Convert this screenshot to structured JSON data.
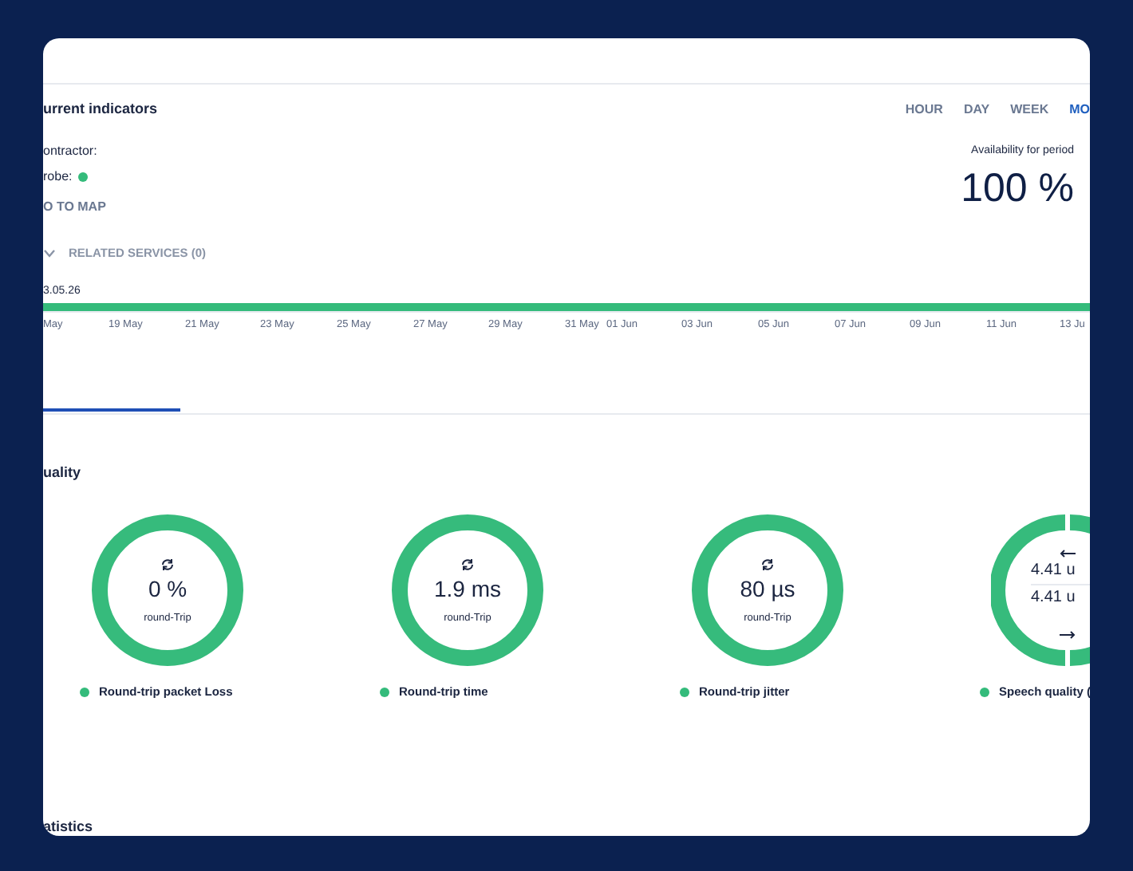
{
  "header": {
    "title": "urrent indicators",
    "periods": [
      {
        "label": "HOUR",
        "selected": false
      },
      {
        "label": "DAY",
        "selected": false
      },
      {
        "label": "WEEK",
        "selected": false
      },
      {
        "label": "MO",
        "selected": true
      }
    ]
  },
  "info": {
    "contractor": "ontractor:",
    "probe": "robe:",
    "map_link": "O TO MAP",
    "related": "RELATED SERVICES (0)"
  },
  "availability": {
    "label": "Availability for period",
    "value": "100 %"
  },
  "timeline": {
    "date": "3.05.26",
    "ticks": [
      "May",
      "19 May",
      "21 May",
      "23 May",
      "25 May",
      "27 May",
      "29 May",
      "31 May",
      "01 Jun",
      "03 Jun",
      "05 Jun",
      "07 Jun",
      "09 Jun",
      "11 Jun",
      "13 Ju"
    ]
  },
  "quality": {
    "title": "uality",
    "gauges": [
      {
        "kind": "single",
        "value": "0 %",
        "caption": "round-Trip",
        "label": "Round-trip packet Loss"
      },
      {
        "kind": "single",
        "value": "1.9 ms",
        "caption": "round-Trip",
        "label": "Round-trip time"
      },
      {
        "kind": "single",
        "value": "80 µs",
        "caption": "round-Trip",
        "label": "Round-trip jitter"
      },
      {
        "kind": "dual",
        "values": [
          "4.41 u",
          "4.41 u"
        ],
        "label": "Speech quality ("
      }
    ]
  },
  "statistics": {
    "title": "atistics"
  }
}
